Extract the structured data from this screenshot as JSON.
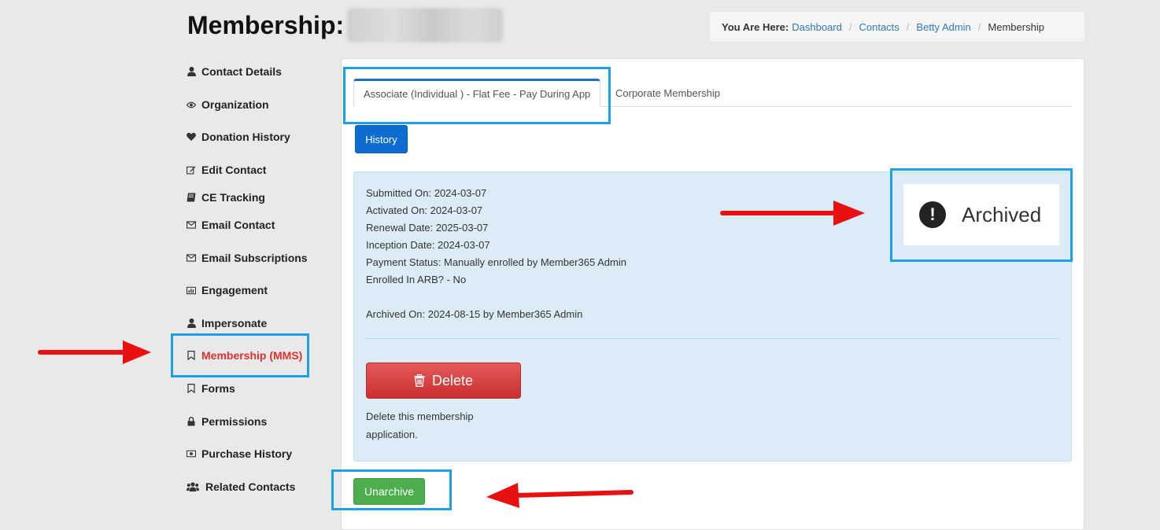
{
  "header": {
    "title": "Membership:"
  },
  "breadcrumb": {
    "label": "You Are Here:",
    "links": [
      "Dashboard",
      "Contacts",
      "Betty Admin"
    ],
    "current": "Membership"
  },
  "sidebar": {
    "items": [
      {
        "label": "Contact Details",
        "icon": "user-icon"
      },
      {
        "label": "Organization",
        "icon": "eye-icon"
      },
      {
        "label": "Donation History",
        "icon": "heart-icon"
      },
      {
        "label": "Edit Contact",
        "icon": "edit-icon"
      },
      {
        "label": "CE Tracking",
        "icon": "book-icon"
      },
      {
        "label": "Email Contact",
        "icon": "envelope-icon"
      },
      {
        "label": "Email Subscriptions",
        "icon": "envelope-icon"
      },
      {
        "label": "Engagement",
        "icon": "bar-chart-icon"
      },
      {
        "label": "Impersonate",
        "icon": "user-icon"
      },
      {
        "label": "Membership (MMS)",
        "icon": "bookmark-icon",
        "active": true
      },
      {
        "label": "Forms",
        "icon": "bookmark-icon"
      },
      {
        "label": "Permissions",
        "icon": "lock-icon"
      },
      {
        "label": "Purchase History",
        "icon": "money-icon"
      },
      {
        "label": "Related Contacts",
        "icon": "users-icon"
      }
    ]
  },
  "tabs": [
    {
      "label": "Associate (Individual ) - Flat Fee - Pay During App",
      "active": true
    },
    {
      "label": "Corporate Membership",
      "active": false
    }
  ],
  "history_button": "History",
  "membership": {
    "submitted_on": "Submitted On: 2024-03-07",
    "activated_on": "Activated On: 2024-03-07",
    "renewal_date": "Renewal Date: 2025-03-07",
    "inception_date": "Inception Date: 2024-03-07",
    "payment_status": "Payment Status: Manually enrolled by Member365 Admin",
    "enrolled_arb": "Enrolled In ARB? - No",
    "archived_on": "Archived On: 2024-08-15 by Member365 Admin"
  },
  "status": {
    "label": "Archived",
    "icon": "exclamation-circle-icon"
  },
  "delete": {
    "button_label": "Delete",
    "description": "Delete this membership application."
  },
  "unarchive_button": "Unarchive",
  "colors": {
    "highlight": "#1ea0e8",
    "arrow": "#e81010",
    "active_nav": "#e03131",
    "primary": "#0d6ccf",
    "danger": "#cc2f2f",
    "success": "#4cae4c"
  }
}
